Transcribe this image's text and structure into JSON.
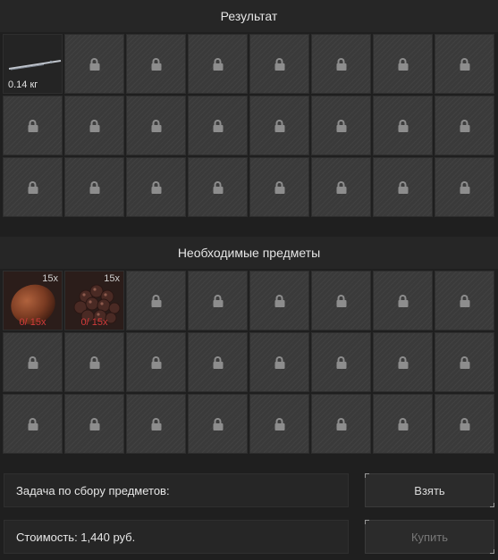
{
  "result_section": {
    "title": "Результат",
    "items": [
      {
        "slot": 0,
        "name": "rod-icon",
        "weight": "0.14 кг"
      }
    ]
  },
  "required_section": {
    "title": "Необходимые предметы",
    "items": [
      {
        "slot": 0,
        "name": "egg-icon",
        "count": "15x",
        "progress": "0/ 15x"
      },
      {
        "slot": 1,
        "name": "berries-icon",
        "count": "15x",
        "progress": "0/ 15x"
      }
    ]
  },
  "task": {
    "label": "Задача по сбору предметов:"
  },
  "cost": {
    "label": "Стоимость: 1,440 руб."
  },
  "buttons": {
    "take": "Взять",
    "buy": "Купить"
  },
  "colors": {
    "progress_missing": "#d23b3b",
    "button_disabled_text": "#777777"
  },
  "grid": {
    "columns": 8,
    "rows": 3,
    "locked_icon": "lock-icon"
  }
}
